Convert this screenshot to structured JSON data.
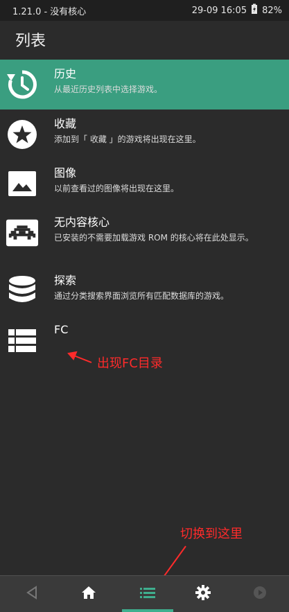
{
  "status": {
    "left_text": "1.21.0 - 没有核心",
    "datetime": "29-09 16:05",
    "battery": "82%"
  },
  "header": {
    "title": "列表"
  },
  "menu": {
    "items": [
      {
        "label": "历史",
        "sub": "从最近历史列表中选择游戏。",
        "icon": "history-icon"
      },
      {
        "label": "收藏",
        "sub": "添加到「 收藏 」的游戏将出现在这里。",
        "icon": "star-icon"
      },
      {
        "label": "图像",
        "sub": "以前查看过的图像将出现在这里。",
        "icon": "image-icon"
      },
      {
        "label": "无内容核心",
        "sub": "已安装的不需要加载游戏 ROM 的核心将在此处显示。",
        "icon": "invader-icon"
      },
      {
        "label": "探索",
        "sub": "通过分类搜索界面浏览所有匹配数据库的游戏。",
        "icon": "database-icon"
      },
      {
        "label": "FC",
        "sub": "",
        "icon": "list-icon"
      }
    ]
  },
  "annotations": {
    "fc_note": "出现FC目录",
    "switch_note": "切换到这里"
  },
  "bottom_nav": {
    "tabs": [
      "back-icon",
      "home-icon",
      "list-icon",
      "gear-icon",
      "play-icon"
    ],
    "active_tab": "list-icon"
  },
  "colors": {
    "accent": "#3a9e80",
    "background": "#2b2b2b",
    "annotation": "#ff2b2b"
  }
}
